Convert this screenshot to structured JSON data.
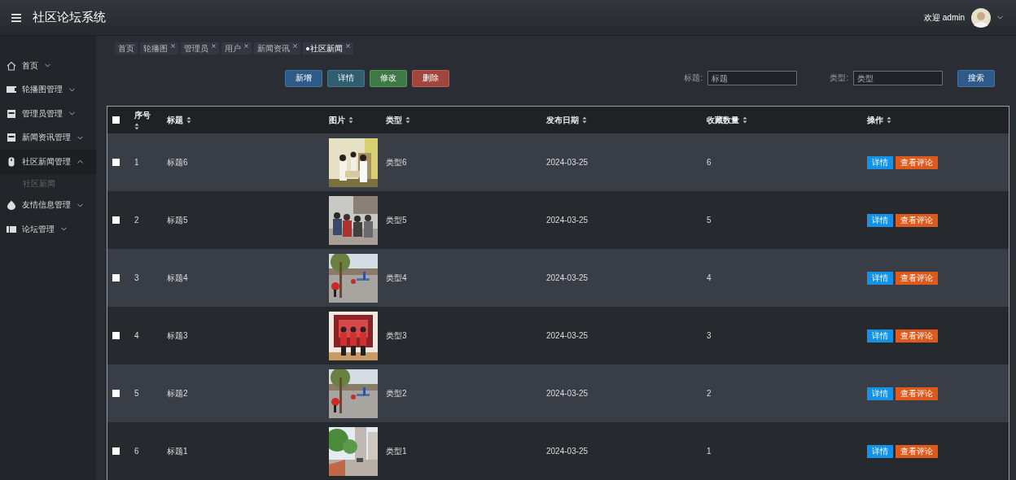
{
  "header": {
    "title": "社区论坛系统",
    "welcome": "欢迎 admin"
  },
  "sidebar": {
    "items": [
      {
        "label": "首页",
        "expanded": false
      },
      {
        "label": "轮播图管理",
        "expanded": false
      },
      {
        "label": "管理员管理",
        "expanded": false
      },
      {
        "label": "新闻资讯管理",
        "expanded": false
      },
      {
        "label": "社区新闻管理",
        "expanded": true,
        "children": [
          {
            "label": "社区新闻",
            "selected": false
          }
        ]
      },
      {
        "label": "友情信息管理",
        "expanded": false
      },
      {
        "label": "论坛管理",
        "expanded": false
      }
    ]
  },
  "tabs": [
    {
      "label": "首页",
      "closable": false,
      "selected": false
    },
    {
      "label": "轮播图",
      "closable": true,
      "selected": false
    },
    {
      "label": "管理员",
      "closable": true,
      "selected": false
    },
    {
      "label": "用户",
      "closable": true,
      "selected": false
    },
    {
      "label": "新闻资讯",
      "closable": true,
      "selected": false
    },
    {
      "label": "社区新闻",
      "closable": true,
      "selected": true
    }
  ],
  "toolbar": {
    "buttons": [
      {
        "label": "新增",
        "kind": "add"
      },
      {
        "label": "详情",
        "kind": "detail"
      },
      {
        "label": "修改",
        "kind": "edit"
      },
      {
        "label": "删除",
        "kind": "delete"
      }
    ],
    "search_fields": [
      {
        "label": "标题:",
        "placeholder": "标题"
      },
      {
        "label": "类型:",
        "placeholder": "类型"
      }
    ],
    "search_button": "搜索"
  },
  "table": {
    "select_all": {
      "checked": false
    },
    "columns": [
      {
        "label": "序号"
      },
      {
        "label": "标题"
      },
      {
        "label": "图片"
      },
      {
        "label": "类型"
      },
      {
        "label": "发布日期"
      },
      {
        "label": "收藏数量"
      },
      {
        "label": "操作"
      }
    ],
    "rows": [
      {
        "checked": false,
        "index": "1",
        "title": "标题6",
        "type": "类型6",
        "date": "2024-03-25",
        "favorites": "6",
        "actions": [
          {
            "label": "详情",
            "kind": "detail"
          },
          {
            "label": "查看评论",
            "kind": "comments"
          }
        ]
      },
      {
        "checked": false,
        "index": "2",
        "title": "标题5",
        "type": "类型5",
        "date": "2024-03-25",
        "favorites": "5",
        "actions": [
          {
            "label": "详情",
            "kind": "detail"
          },
          {
            "label": "查看评论",
            "kind": "comments"
          }
        ]
      },
      {
        "checked": false,
        "index": "3",
        "title": "标题4",
        "type": "类型4",
        "date": "2024-03-25",
        "favorites": "4",
        "actions": [
          {
            "label": "详情",
            "kind": "detail"
          },
          {
            "label": "查看评论",
            "kind": "comments"
          }
        ]
      },
      {
        "checked": false,
        "index": "4",
        "title": "标题3",
        "type": "类型3",
        "date": "2024-03-25",
        "favorites": "3",
        "actions": [
          {
            "label": "详情",
            "kind": "detail"
          },
          {
            "label": "查看评论",
            "kind": "comments"
          }
        ]
      },
      {
        "checked": false,
        "index": "5",
        "title": "标题2",
        "type": "类型2",
        "date": "2024-03-25",
        "favorites": "2",
        "actions": [
          {
            "label": "详情",
            "kind": "detail"
          },
          {
            "label": "查看评论",
            "kind": "comments"
          }
        ]
      },
      {
        "checked": false,
        "index": "6",
        "title": "标题1",
        "type": "类型1",
        "date": "2024-03-25",
        "favorites": "1",
        "actions": [
          {
            "label": "详情",
            "kind": "detail"
          },
          {
            "label": "查看评论",
            "kind": "comments"
          }
        ]
      }
    ]
  }
}
